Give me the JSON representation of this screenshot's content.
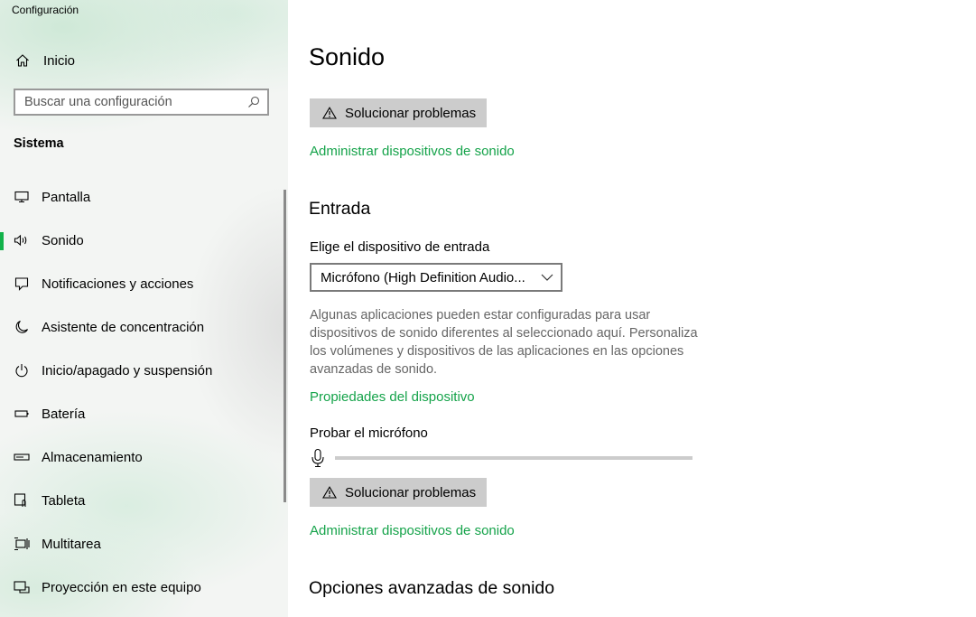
{
  "window": {
    "title": "Configuración"
  },
  "sidebar": {
    "home_label": "Inicio",
    "search_placeholder": "Buscar una configuración",
    "section_title": "Sistema",
    "items": [
      {
        "label": "Pantalla",
        "icon": "monitor-icon"
      },
      {
        "label": "Sonido",
        "icon": "speaker-icon",
        "active": true
      },
      {
        "label": "Notificaciones y acciones",
        "icon": "notification-icon"
      },
      {
        "label": "Asistente de concentración",
        "icon": "moon-icon"
      },
      {
        "label": "Inicio/apagado y suspensión",
        "icon": "power-icon"
      },
      {
        "label": "Batería",
        "icon": "battery-icon"
      },
      {
        "label": "Almacenamiento",
        "icon": "storage-icon"
      },
      {
        "label": "Tableta",
        "icon": "tablet-icon"
      },
      {
        "label": "Multitarea",
        "icon": "multitask-icon"
      },
      {
        "label": "Proyección en este equipo",
        "icon": "projection-icon"
      }
    ]
  },
  "main": {
    "title": "Sonido",
    "troubleshoot_label": "Solucionar problemas",
    "manage_devices_link": "Administrar dispositivos de sonido",
    "input": {
      "heading": "Entrada",
      "choose_label": "Elige el dispositivo de entrada",
      "selected_device": "Micrófono (High Definition Audio...",
      "description": "Algunas aplicaciones pueden estar configuradas para usar dispositivos de sonido diferentes al seleccionado aquí. Personaliza los volúmenes y dispositivos de las aplicaciones en las opciones avanzadas de sonido.",
      "properties_link": "Propiedades del dispositivo",
      "test_label": "Probar el micrófono",
      "mic_level": 0,
      "troubleshoot_label": "Solucionar problemas",
      "manage_devices_link": "Administrar dispositivos de sonido"
    },
    "advanced_heading": "Opciones avanzadas de sonido"
  },
  "colors": {
    "accent": "#12b24a",
    "link": "#15a34a",
    "button_bg": "#cccccc"
  }
}
